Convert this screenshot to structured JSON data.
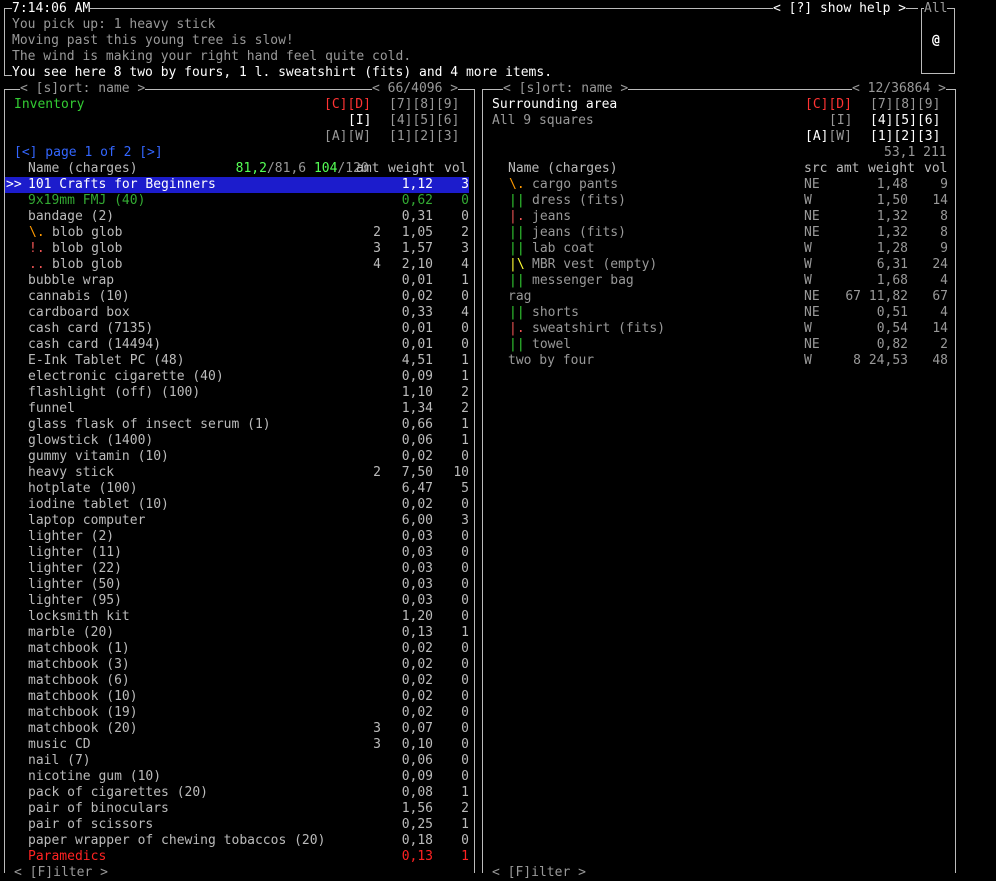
{
  "header": {
    "time": "7:14:06 AM",
    "help": "< [?] show help >",
    "all_label": "All",
    "player_glyph": "@",
    "messages": [
      "You pick up: 1 heavy stick",
      "Moving past this young tree is slow!",
      "The wind is making your right hand feel quite cold.",
      "You see here 8 two by fours, 1 l. sweatshirt (fits) and 4 more items."
    ]
  },
  "left": {
    "sort_label": "< [s]ort: name >",
    "count": "< 66/4096 >",
    "title": "Inventory",
    "cd": "[C][D]",
    "n789": "[7][8][9]",
    "i_key": "[I]",
    "n456": "[4][5][6]",
    "aw": "[A][W]",
    "n123": "[1][2][3]",
    "page_label": "[<] page 1 of 2 [>]",
    "weight_a": "81,2",
    "weight_b": "/81,6 ",
    "volume_a": "104",
    "volume_b": "/120",
    "headers": {
      "name": "Name (charges)",
      "amt": "amt",
      "weight": "weight",
      "vol": "vol"
    },
    "filter_label": "< [F]ilter >",
    "items": [
      {
        "mark": "",
        "name": "101 Crafts for Beginners",
        "amt": "",
        "weight": "1,12",
        "vol": "3",
        "selected": true
      },
      {
        "mark": "",
        "name": "9x19mm FMJ (40)",
        "amt": "",
        "weight": "0,62",
        "vol": "0",
        "color": "green"
      },
      {
        "mark": "",
        "name": "bandage (2)",
        "amt": "",
        "weight": "0,31",
        "vol": "0"
      },
      {
        "mark": "\\.",
        "markcolor": "orange",
        "name": "blob glob",
        "amt": "2",
        "weight": "1,05",
        "vol": "2"
      },
      {
        "mark": "!.",
        "markcolor": "pink",
        "name": "blob glob",
        "amt": "3",
        "weight": "1,57",
        "vol": "3"
      },
      {
        "mark": "..",
        "markcolor": "pink",
        "name": "blob glob",
        "amt": "4",
        "weight": "2,10",
        "vol": "4"
      },
      {
        "mark": "",
        "name": "bubble wrap",
        "amt": "",
        "weight": "0,01",
        "vol": "1"
      },
      {
        "mark": "",
        "name": "cannabis (10)",
        "amt": "",
        "weight": "0,02",
        "vol": "0"
      },
      {
        "mark": "",
        "name": "cardboard box",
        "amt": "",
        "weight": "0,33",
        "vol": "4"
      },
      {
        "mark": "",
        "name": "cash card (7135)",
        "amt": "",
        "weight": "0,01",
        "vol": "0"
      },
      {
        "mark": "",
        "name": "cash card (14494)",
        "amt": "",
        "weight": "0,01",
        "vol": "0"
      },
      {
        "mark": "",
        "name": "E-Ink Tablet PC (48)",
        "amt": "",
        "weight": "4,51",
        "vol": "1"
      },
      {
        "mark": "",
        "name": "electronic cigarette (40)",
        "amt": "",
        "weight": "0,09",
        "vol": "1"
      },
      {
        "mark": "",
        "name": "flashlight (off) (100)",
        "amt": "",
        "weight": "1,10",
        "vol": "2"
      },
      {
        "mark": "",
        "name": "funnel",
        "amt": "",
        "weight": "1,34",
        "vol": "2"
      },
      {
        "mark": "",
        "name": "glass flask of insect serum (1)",
        "amt": "",
        "weight": "0,66",
        "vol": "1"
      },
      {
        "mark": "",
        "name": "glowstick (1400)",
        "amt": "",
        "weight": "0,06",
        "vol": "1"
      },
      {
        "mark": "",
        "name": "gummy vitamin (10)",
        "amt": "",
        "weight": "0,02",
        "vol": "0"
      },
      {
        "mark": "",
        "name": "heavy stick",
        "amt": "2",
        "weight": "7,50",
        "vol": "10"
      },
      {
        "mark": "",
        "name": "hotplate (100)",
        "amt": "",
        "weight": "6,47",
        "vol": "5"
      },
      {
        "mark": "",
        "name": "iodine tablet (10)",
        "amt": "",
        "weight": "0,02",
        "vol": "0"
      },
      {
        "mark": "",
        "name": "laptop computer",
        "amt": "",
        "weight": "6,00",
        "vol": "3"
      },
      {
        "mark": "",
        "name": "lighter (2)",
        "amt": "",
        "weight": "0,03",
        "vol": "0"
      },
      {
        "mark": "",
        "name": "lighter (11)",
        "amt": "",
        "weight": "0,03",
        "vol": "0"
      },
      {
        "mark": "",
        "name": "lighter (22)",
        "amt": "",
        "weight": "0,03",
        "vol": "0"
      },
      {
        "mark": "",
        "name": "lighter (50)",
        "amt": "",
        "weight": "0,03",
        "vol": "0"
      },
      {
        "mark": "",
        "name": "lighter (95)",
        "amt": "",
        "weight": "0,03",
        "vol": "0"
      },
      {
        "mark": "",
        "name": "locksmith kit",
        "amt": "",
        "weight": "1,20",
        "vol": "0"
      },
      {
        "mark": "",
        "name": "marble (20)",
        "amt": "",
        "weight": "0,13",
        "vol": "1"
      },
      {
        "mark": "",
        "name": "matchbook (1)",
        "amt": "",
        "weight": "0,02",
        "vol": "0"
      },
      {
        "mark": "",
        "name": "matchbook (3)",
        "amt": "",
        "weight": "0,02",
        "vol": "0"
      },
      {
        "mark": "",
        "name": "matchbook (6)",
        "amt": "",
        "weight": "0,02",
        "vol": "0"
      },
      {
        "mark": "",
        "name": "matchbook (10)",
        "amt": "",
        "weight": "0,02",
        "vol": "0"
      },
      {
        "mark": "",
        "name": "matchbook (19)",
        "amt": "",
        "weight": "0,02",
        "vol": "0"
      },
      {
        "mark": "",
        "name": "matchbook (20)",
        "amt": "3",
        "weight": "0,07",
        "vol": "0"
      },
      {
        "mark": "",
        "name": "music CD",
        "amt": "3",
        "weight": "0,10",
        "vol": "0"
      },
      {
        "mark": "",
        "name": "nail (7)",
        "amt": "",
        "weight": "0,06",
        "vol": "0"
      },
      {
        "mark": "",
        "name": "nicotine gum (10)",
        "amt": "",
        "weight": "0,09",
        "vol": "0"
      },
      {
        "mark": "",
        "name": "pack of cigarettes (20)",
        "amt": "",
        "weight": "0,08",
        "vol": "1"
      },
      {
        "mark": "",
        "name": "pair of binoculars",
        "amt": "",
        "weight": "1,56",
        "vol": "2"
      },
      {
        "mark": "",
        "name": "pair of scissors",
        "amt": "",
        "weight": "0,25",
        "vol": "1"
      },
      {
        "mark": "",
        "name": "paper wrapper of chewing tobaccos (20)",
        "amt": "",
        "weight": "0,18",
        "vol": "0"
      },
      {
        "mark": "",
        "name": "Paramedics",
        "amt": "",
        "weight": "0,13",
        "vol": "1",
        "color": "red"
      }
    ]
  },
  "right": {
    "sort_label": "< [s]ort: name >",
    "count": "< 12/36864 >",
    "title": "Surrounding area",
    "subtitle": "All 9 squares",
    "cd": "[C][D]",
    "n789": "[7][8][9]",
    "i_key": "[I]",
    "n456": "[4][5][6]",
    "a_key": "[A]",
    "w_key": "[W]",
    "n123": "[1][2][3]",
    "weight_vol": "53,1 211",
    "headers": {
      "name": "Name (charges)",
      "src": "src",
      "amt": "amt",
      "weight": "weight",
      "vol": "vol"
    },
    "filter_label": "< [F]ilter >",
    "items": [
      {
        "mark": "\\.",
        "markcolor": "orange",
        "name": "cargo pants",
        "src": "NE",
        "amt": "",
        "weight": "1,48",
        "vol": "9"
      },
      {
        "mark": "||",
        "markcolor": "green",
        "name": "dress (fits)",
        "src": "W",
        "amt": "",
        "weight": "1,50",
        "vol": "14"
      },
      {
        "mark": "|.",
        "markcolor": "pink",
        "name": "jeans",
        "src": "NE",
        "amt": "",
        "weight": "1,32",
        "vol": "8"
      },
      {
        "mark": "||",
        "markcolor": "green",
        "name": "jeans (fits)",
        "src": "NE",
        "amt": "",
        "weight": "1,32",
        "vol": "8"
      },
      {
        "mark": "||",
        "markcolor": "green",
        "name": "lab coat",
        "src": "W",
        "amt": "",
        "weight": "1,28",
        "vol": "9"
      },
      {
        "mark": "|\\",
        "markcolor": "yellow",
        "name": "MBR vest (empty)",
        "src": "W",
        "amt": "",
        "weight": "6,31",
        "vol": "24"
      },
      {
        "mark": "||",
        "markcolor": "green",
        "name": "messenger bag",
        "src": "W",
        "amt": "",
        "weight": "1,68",
        "vol": "4"
      },
      {
        "mark": "",
        "name": "rag",
        "src": "NE",
        "amt": "67",
        "weight": "11,82",
        "vol": "67"
      },
      {
        "mark": "||",
        "markcolor": "green",
        "name": "shorts",
        "src": "NE",
        "amt": "",
        "weight": "0,51",
        "vol": "4"
      },
      {
        "mark": "|.",
        "markcolor": "pink",
        "name": "sweatshirt (fits)",
        "src": "W",
        "amt": "",
        "weight": "0,54",
        "vol": "14"
      },
      {
        "mark": "||",
        "markcolor": "green",
        "name": "towel",
        "src": "NE",
        "amt": "",
        "weight": "0,82",
        "vol": "2"
      },
      {
        "mark": "",
        "name": "two by four",
        "src": "W",
        "amt": "8",
        "weight": "24,53",
        "vol": "48"
      }
    ]
  }
}
